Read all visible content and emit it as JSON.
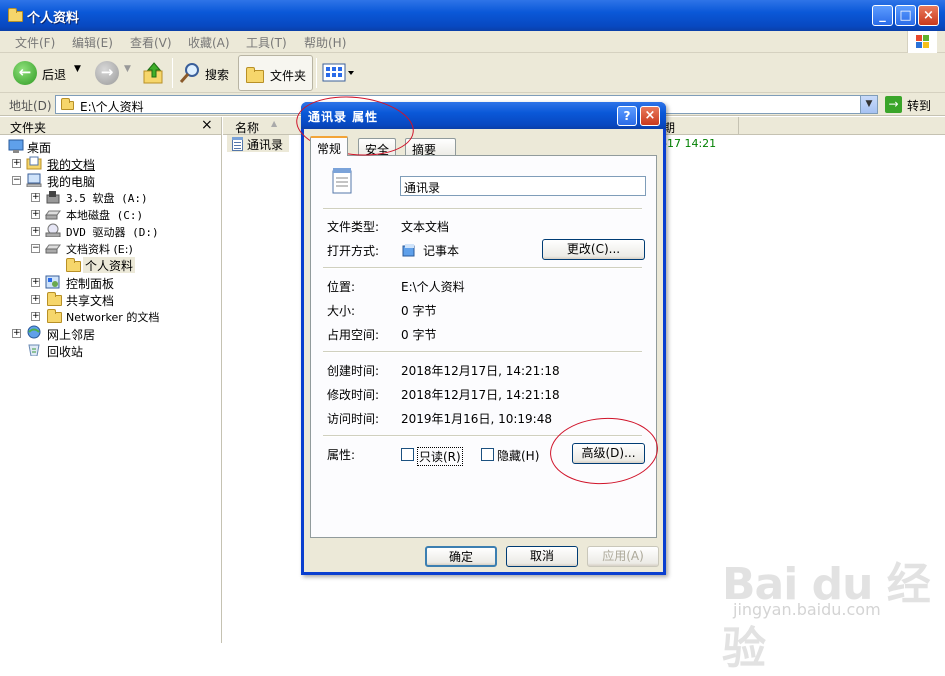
{
  "window": {
    "title": "个人资料"
  },
  "menu": [
    "文件(F)",
    "编辑(E)",
    "查看(V)",
    "收藏(A)",
    "工具(T)",
    "帮助(H)"
  ],
  "toolbar": {
    "back": "后退",
    "search": "搜索",
    "folders": "文件夹"
  },
  "address": {
    "label": "地址(D)",
    "value": "E:\\个人资料",
    "go": "转到"
  },
  "folder_pane": {
    "title": "文件夹",
    "close": "×",
    "items": [
      {
        "label": "桌面",
        "icon": "desktop-icon"
      },
      {
        "label": "我的文档",
        "icon": "my-documents-icon"
      },
      {
        "label": "我的电脑",
        "icon": "my-computer-icon"
      },
      {
        "label": "3.5 软盘 (A:)",
        "icon": "floppy-icon"
      },
      {
        "label": "本地磁盘 (C:)",
        "icon": "hard-drive-icon"
      },
      {
        "label": "DVD 驱动器 (D:)",
        "icon": "dvd-drive-icon"
      },
      {
        "label": "文档资料 (E:)",
        "icon": "hard-drive-icon"
      },
      {
        "label": "个人资料",
        "icon": "open-folder-icon"
      },
      {
        "label": "控制面板",
        "icon": "control-panel-icon"
      },
      {
        "label": "共享文档",
        "icon": "folder-icon"
      },
      {
        "label": "Networker 的文档",
        "icon": "folder-icon"
      },
      {
        "label": "网上邻居",
        "icon": "network-icon"
      },
      {
        "label": "回收站",
        "icon": "recycle-bin-icon"
      }
    ]
  },
  "list": {
    "col_name": "名称",
    "col_date": "期",
    "file_name": "通讯录",
    "file_date": "-17 14:21"
  },
  "dialog": {
    "title": "通讯录 属性",
    "help": "?",
    "tabs": [
      "常规",
      "安全",
      "摘要"
    ],
    "filename": "通讯录",
    "type_label": "文件类型:",
    "type_value": "文本文档",
    "open_label": "打开方式:",
    "open_value": "记事本",
    "change_btn": "更改(C)...",
    "location_label": "位置:",
    "location_value": "E:\\个人资料",
    "size_label": "大小:",
    "size_value": "0 字节",
    "disk_label": "占用空间:",
    "disk_value": "0 字节",
    "created_label": "创建时间:",
    "created_value": "2018年12月17日, 14:21:18",
    "modified_label": "修改时间:",
    "modified_value": "2018年12月17日, 14:21:18",
    "accessed_label": "访问时间:",
    "accessed_value": "2019年1月16日, 10:19:48",
    "attr_label": "属性:",
    "readonly": "只读(R)",
    "hidden": "隐藏(H)",
    "advanced_btn": "高级(D)...",
    "ok": "确定",
    "cancel": "取消",
    "apply": "应用(A)"
  },
  "watermark": {
    "logo": "Bai du 经验",
    "url": "jingyan.baidu.com"
  },
  "colors": {
    "xp_blue": "#0a58d8",
    "dialog_face": "#ece9d8",
    "highlight_red": "#d0142a",
    "date_green": "#008000"
  }
}
